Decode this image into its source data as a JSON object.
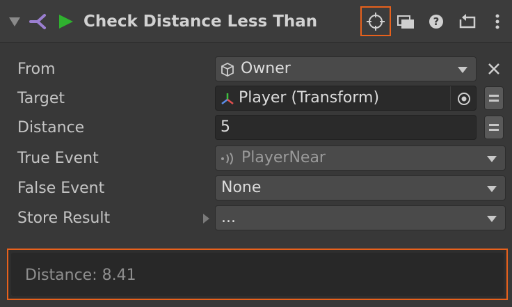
{
  "header": {
    "title": "Check Distance Less Than"
  },
  "fields": {
    "from": {
      "label": "From",
      "value": "Owner"
    },
    "target": {
      "label": "Target",
      "value": "Player (Transform)"
    },
    "distance": {
      "label": "Distance",
      "value": "5"
    },
    "true_event": {
      "label": "True Event",
      "value": "PlayerNear"
    },
    "false_event": {
      "label": "False Event",
      "value": "None"
    },
    "store_result": {
      "label": "Store Result",
      "value": "..."
    }
  },
  "debug": {
    "text": "Distance: 8.41"
  },
  "colors": {
    "highlight": "#e8611c",
    "play_green": "#2fb12f",
    "action_purple": "#9b7fd1"
  }
}
